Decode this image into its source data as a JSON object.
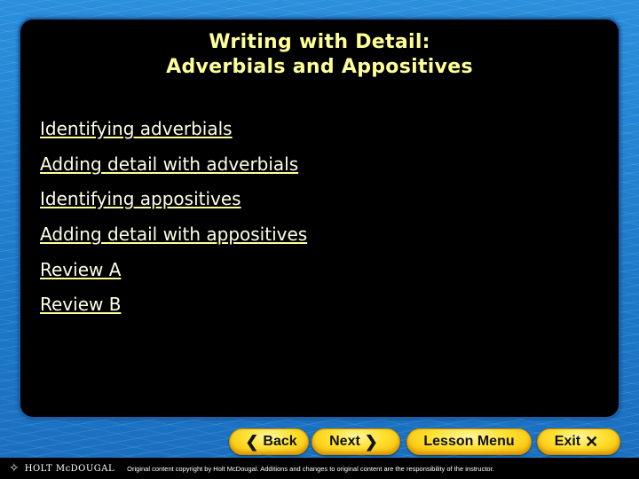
{
  "slide": {
    "title_line1": "Writing with Detail:",
    "title_line2": "Adverbials and Appositives",
    "links": [
      "Identifying adverbials",
      "Adding detail with adverbials",
      "Identifying appositives",
      "Adding detail with appositives",
      "Review A",
      "Review B"
    ]
  },
  "nav": {
    "back": {
      "label": "Back",
      "icon": "chevron-left-icon",
      "glyph": "❮"
    },
    "next": {
      "label": "Next",
      "icon": "chevron-right-icon",
      "glyph": "❯"
    },
    "lesson_menu": {
      "label": "Lesson Menu"
    },
    "exit": {
      "label": "Exit",
      "icon": "close-icon",
      "glyph": "✕"
    }
  },
  "footer": {
    "logo_text": "HOLT McDOUGAL",
    "logo_glyph": "✧",
    "copyright": "Original content copyright by Holt McDougal. Additions and changes to original content are the responsibility of the instructor."
  },
  "colors": {
    "title": "#ffff99",
    "link": "#ffffe6",
    "panel": "#000000",
    "background": "#1f7fcf",
    "button": "#ffe030"
  }
}
